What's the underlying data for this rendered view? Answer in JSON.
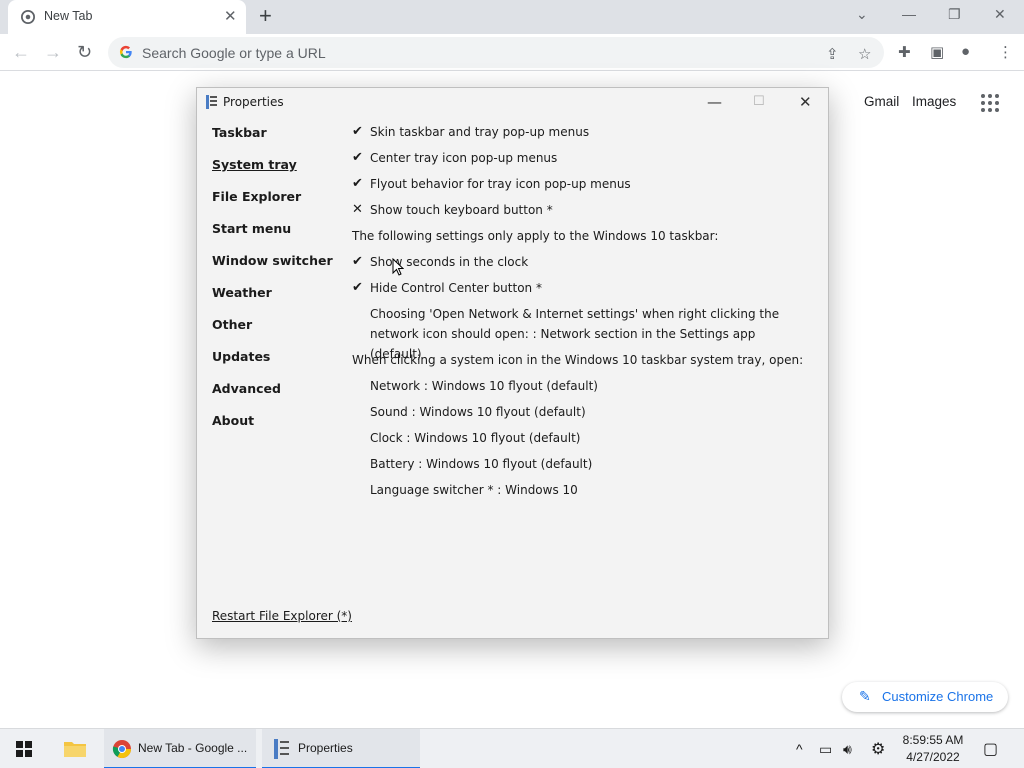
{
  "browser": {
    "tab": {
      "title": "New Tab",
      "close": "✕"
    },
    "new_tab": "+",
    "window_controls": {
      "tab_search": "⌄",
      "minimize": "—",
      "restore": "❐",
      "close": "✕"
    },
    "nav": {
      "back": "←",
      "forward": "→",
      "reload": "↻"
    },
    "omnibox": {
      "placeholder": "Search Google or type a URL"
    },
    "toolbar_icons": {
      "share": "⇪",
      "bookmark": "☆",
      "extensions": "✚",
      "side_panel": "▣",
      "profile": "●",
      "menu": "⋮"
    }
  },
  "ntp": {
    "gmail": "Gmail",
    "images": "Images",
    "customize": {
      "icon": "✎",
      "label": "Customize Chrome"
    }
  },
  "properties": {
    "title": "Properties",
    "controls": {
      "minimize": "—",
      "maximize": "☐",
      "close": "✕"
    },
    "nav": [
      "Taskbar",
      "System tray",
      "File Explorer",
      "Start menu",
      "Window switcher",
      "Weather",
      "Other",
      "Updates",
      "Advanced",
      "About"
    ],
    "active_nav": "System tray",
    "settings": [
      {
        "mark": "✔",
        "text": "Skin taskbar and tray pop-up menus"
      },
      {
        "mark": "✔",
        "text": "Center tray icon pop-up menus"
      },
      {
        "mark": "✔",
        "text": "Flyout behavior for tray icon pop-up menus"
      },
      {
        "mark": "✕",
        "text": "Show touch keyboard button *"
      },
      {
        "mark": "",
        "text": "The following settings only apply to the Windows 10 taskbar:"
      },
      {
        "mark": "✔",
        "text": "Show seconds in the clock"
      },
      {
        "mark": "✔",
        "text": "Hide Control Center button *"
      },
      {
        "mark": "",
        "text": "Choosing 'Open Network & Internet settings' when right clicking the network icon should open: : Network section in the Settings app (default)"
      },
      {
        "mark": "",
        "text": "When clicking a system icon in the Windows 10 taskbar system tray, open:"
      },
      {
        "mark": "",
        "text": "Network : Windows 10 flyout (default)"
      },
      {
        "mark": "",
        "text": "Sound : Windows 10 flyout (default)"
      },
      {
        "mark": "",
        "text": "Clock : Windows 10 flyout (default)"
      },
      {
        "mark": "",
        "text": "Battery : Windows 10 flyout (default)"
      },
      {
        "mark": "",
        "text": "Language switcher * : Windows 10"
      }
    ],
    "restart_link": "Restart File Explorer (*)"
  },
  "taskbar": {
    "apps": [
      {
        "label": ""
      },
      {
        "label": "New Tab - Google ..."
      },
      {
        "label": "Properties"
      }
    ],
    "tray": {
      "chevron": "^",
      "network": "▭",
      "volume": "🔊︎",
      "settings": "⚙",
      "notifications": "▢"
    },
    "clock": {
      "time": "8:59:55 AM",
      "date": "4/27/2022"
    }
  },
  "colors": {
    "accent": "#1a73e8",
    "tabstrip": "#dee1e6",
    "window_bg": "#f3f3f3",
    "taskbar": "#eef0f3"
  }
}
